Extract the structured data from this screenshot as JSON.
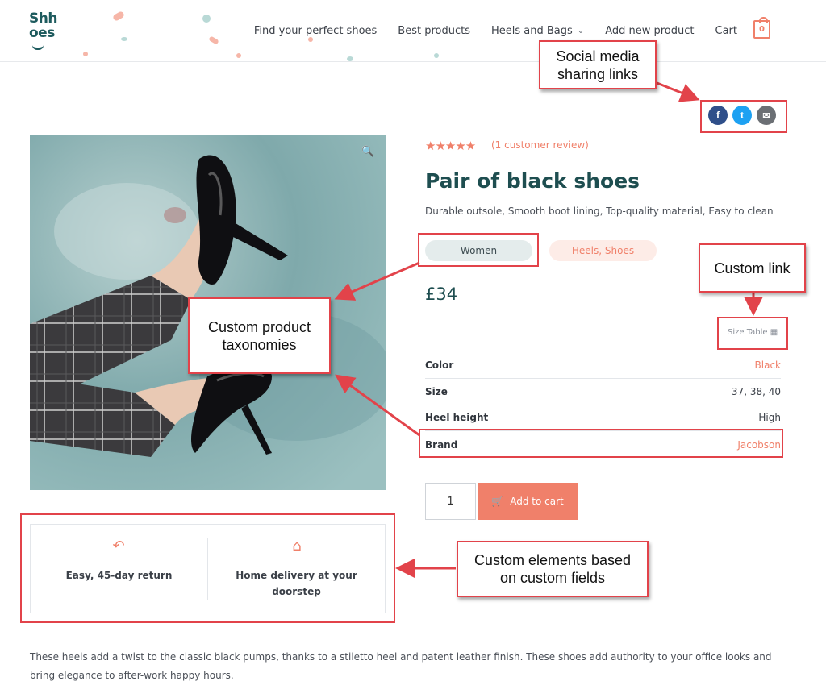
{
  "header": {
    "logo_line1": "Shh",
    "logo_line2": "oes",
    "nav": [
      "Find your perfect shoes",
      "Best products",
      "Heels and Bags",
      "Add new product",
      "Cart"
    ],
    "cart_count": "0"
  },
  "annotations": {
    "social": "Social media sharing links",
    "custom_link": "Custom link",
    "taxonomies": "Custom product taxonomies",
    "custom_elements": "Custom elements based on custom fields"
  },
  "share": {
    "facebook": "f",
    "twitter": "t",
    "email": "✉"
  },
  "product": {
    "stars": "★★★★★",
    "review_link": "(1 customer review)",
    "title": "Pair of black shoes",
    "short_desc": "Durable outsole, Smooth boot lining, Top-quality material, Easy to clean",
    "tag1": "Women",
    "tag2": "Heels, Shoes",
    "price": "£34",
    "size_table": "Size Table",
    "attributes": [
      {
        "key": "Color",
        "value": "Black"
      },
      {
        "key": "Size",
        "value": "37, 38, 40"
      },
      {
        "key": "Heel height",
        "value": "High"
      },
      {
        "key": "Brand",
        "value": "Jacobson"
      }
    ],
    "qty": "1",
    "add_to_cart": "Add to cart"
  },
  "features": [
    {
      "icon": "return-icon",
      "text": "Easy, 45-day return"
    },
    {
      "icon": "home-icon",
      "text": "Home delivery at your doorstep"
    }
  ],
  "description": "These heels add a twist to the classic black pumps, thanks to a stiletto heel and patent leather finish. These shoes add authority to your office looks and bring elegance to after-work happy hours.",
  "colors": {
    "accent": "#f0806a",
    "brand": "#1e4e50",
    "annotation_red": "#e2434a",
    "facebook": "#2f4f8a",
    "twitter": "#1da1f2",
    "email": "#6b6f74"
  }
}
